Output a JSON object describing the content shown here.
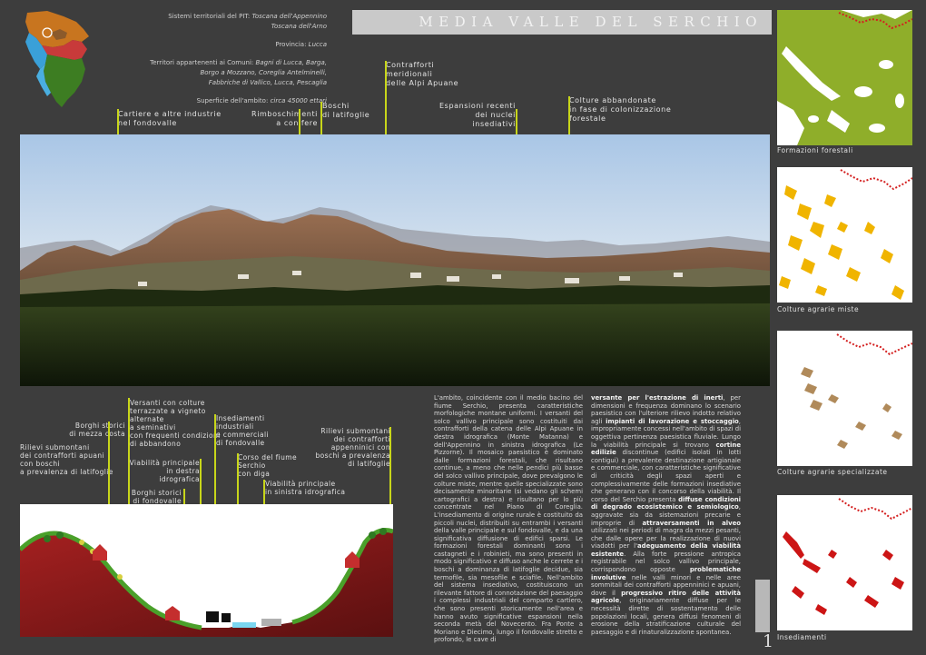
{
  "header": {
    "sistemi_label": "Sistemi territoriali del PIT:",
    "sistemi_value_1": "Toscana dell'Appennino",
    "sistemi_value_2": "Toscana dell'Arno",
    "provincia_label": "Provincia:",
    "provincia_value": "Lucca",
    "comuni_label": "Territori appartenenti ai Comuni:",
    "comuni_value_1": "Bagni di Lucca, Barga,",
    "comuni_value_2": "Borgo a Mozzano, Coreglia Antelminelli,",
    "comuni_value_3": "Fabbriche di Vallico, Lucca, Pescaglia",
    "superficie_label": "Superficie dell'ambito:",
    "superficie_value": "circa 45000 ettari",
    "title": "MEDIA VALLE DEL SERCHIO"
  },
  "panorama_labels": {
    "cartiere_1": "Cartiere e altre industrie",
    "cartiere_2": "nel fondovalle",
    "rimbo_1": "Rimboschimenti",
    "rimbo_2": "a conifere",
    "boschi_1": "Boschi",
    "boschi_2": "di latifoglie",
    "contraff_1": "Contrafforti",
    "contraff_2": "meridionali",
    "contraff_3": "delle Alpi Apuane",
    "espans_1": "Espansioni recenti",
    "espans_2": "dei nuclei insediativi",
    "colture_1": "Colture abbandonate",
    "colture_2": "in fase di colonizzazione",
    "colture_3": "forestale"
  },
  "section_labels": {
    "versanti_1": "Versanti con colture",
    "versanti_2": "terrazzate a vigneto",
    "versanti_3": "alternate",
    "versanti_4": "a seminativi",
    "versanti_5": "con frequenti condizioni",
    "versanti_6": "di abbandono",
    "borghi_mezza_1": "Borghi storici",
    "borghi_mezza_2": "di mezza costa",
    "rilievi_apuani_1": "Rilievi submontani",
    "rilievi_apuani_2": "dei contrafforti apuani",
    "rilievi_apuani_3": "con boschi",
    "rilievi_apuani_4": "a prevalenza di latifoglie",
    "viab_destra_1": "Viabilità principale",
    "viab_destra_2": "in destra",
    "viab_destra_3": "idrografica",
    "insed_1": "Insediamenti",
    "insed_2": "industriali",
    "insed_3": "e commerciali",
    "insed_4": "di fondovalle",
    "corso_1": "Corso del fiume",
    "corso_2": "Serchio",
    "corso_3": "con diga",
    "borghi_fondo_1": "Borghi storici",
    "borghi_fondo_2": "di fondovalle",
    "viab_sinistra_1": "Viabilità principale",
    "viab_sinistra_2": "in sinistra idrografica",
    "rilievi_app_1": "Rilievi submontani",
    "rilievi_app_2": "dei contrafforti",
    "rilievi_app_3": "appenninici con",
    "rilievi_app_4": "boschi a prevalenza",
    "rilievi_app_5": "di latifoglie"
  },
  "body_col1": "L'ambito, coincidente con il medio bacino del fiume Serchio, presenta caratteristiche morfologiche montane uniformi. I versanti del solco vallivo principale sono costituiti dai contrafforti della catena delle Alpi Apuane in destra idrografica (Monte Matanna) e dell'Appennino in sinistra idrografica (Le Pizzorne). Il mosaico paesistico è dominato dalle formazioni forestali, che risultano continue, a meno che nelle pendici più basse del solco vallivo principale, dove prevalgono le colture miste, mentre quelle specializzate sono decisamente minoritarie (si vedano gli schemi cartografici a destra) e risultano per lo più concentrate nel Piano di Coreglia. L'insediamento di origine rurale è costituito da piccoli nuclei, distribuiti su entrambi i versanti della valle principale e sul fondovalle, e da una significativa diffusione di edifici sparsi. Le formazioni forestali dominanti sono i castagneti e i robinieti, ma sono presenti in modo significativo e diffuso anche le cerrete e i boschi a dominanza di latifoglie decidue, sia termofile, sia mesofile e sciafile. Nell'ambito del sistema insediativo, costituiscono un rilevante fattore di connotazione del paesaggio i complessi industriali del comparto cartiero, che sono presenti storicamente nell'area e hanno avuto significative espansioni nella seconda metà del Novecento. Fra Ponte a Moriano e Diecimo, lungo il fondovalle stretto e profondo, le cave di",
  "body_col2": {
    "p1_a": "versante per l'estrazione di inerti",
    "p1_b": ", per dimensioni e frequenza dominano lo scenario paesistico con l'ulteriore rilievo indotto relativo agli ",
    "p1_c": "impianti di lavorazione e stoccaggio",
    "p1_d": ", impropriamente concessi nell'ambito di spazi di oggettiva pertinenza paesistica fluviale.",
    "p2_a": "Lungo la viabilità principale si trovano ",
    "p2_b": "cortine edilizie",
    "p2_c": " discontinue (edifici isolati in lotti contigui) a prevalente destinazione artigianale e commerciale, con caratteristiche significative di criticità degli spazi aperti e complessivamente delle formazioni insediative che generano con il concorso della viabilità.",
    "p3_a": "Il corso del Serchio presenta ",
    "p3_b": "diffuse condizioni di degrado ecosistemico e semiologico",
    "p3_c": ", aggravate sia da sistemazioni precarie e improprie di ",
    "p3_d": "attraversamenti in alveo",
    "p3_e": " utilizzati nei periodi di magra da mezzi pesanti, che dalle opere per la realizzazione di nuovi viadotti per l'",
    "p3_f": "adeguamento della viabilità esistente",
    "p3_g": ".",
    "p4_a": "Alla forte pressione antropica registrabile nel solco vallivo principale, corrispondono opposte ",
    "p4_b": "problematiche involutive",
    "p4_c": " nelle valli minori e nelle aree sommitali dei contrafforti appenninici e apuani, dove il ",
    "p4_d": "progressivo ritiro delle attività agricole",
    "p4_e": ", originariamente diffuse per le necessità dirette di sostentamento delle popolazioni locali, genera diffusi fenomeni di erosione della stratificazione culturale del paesaggio e di rinaturalizzazione spontanea."
  },
  "thumbs": {
    "cap1": "Formazioni forestali",
    "cap2": "Colture agrarie miste",
    "cap3": "Colture agrarie specializzate",
    "cap4": "Insediamenti"
  },
  "page_number": "1",
  "colors": {
    "accent_line": "#c8d61a",
    "forest": "#8fae2a",
    "mixed": "#f0b400",
    "special": "#b08a5a",
    "settle": "#cc1515"
  }
}
